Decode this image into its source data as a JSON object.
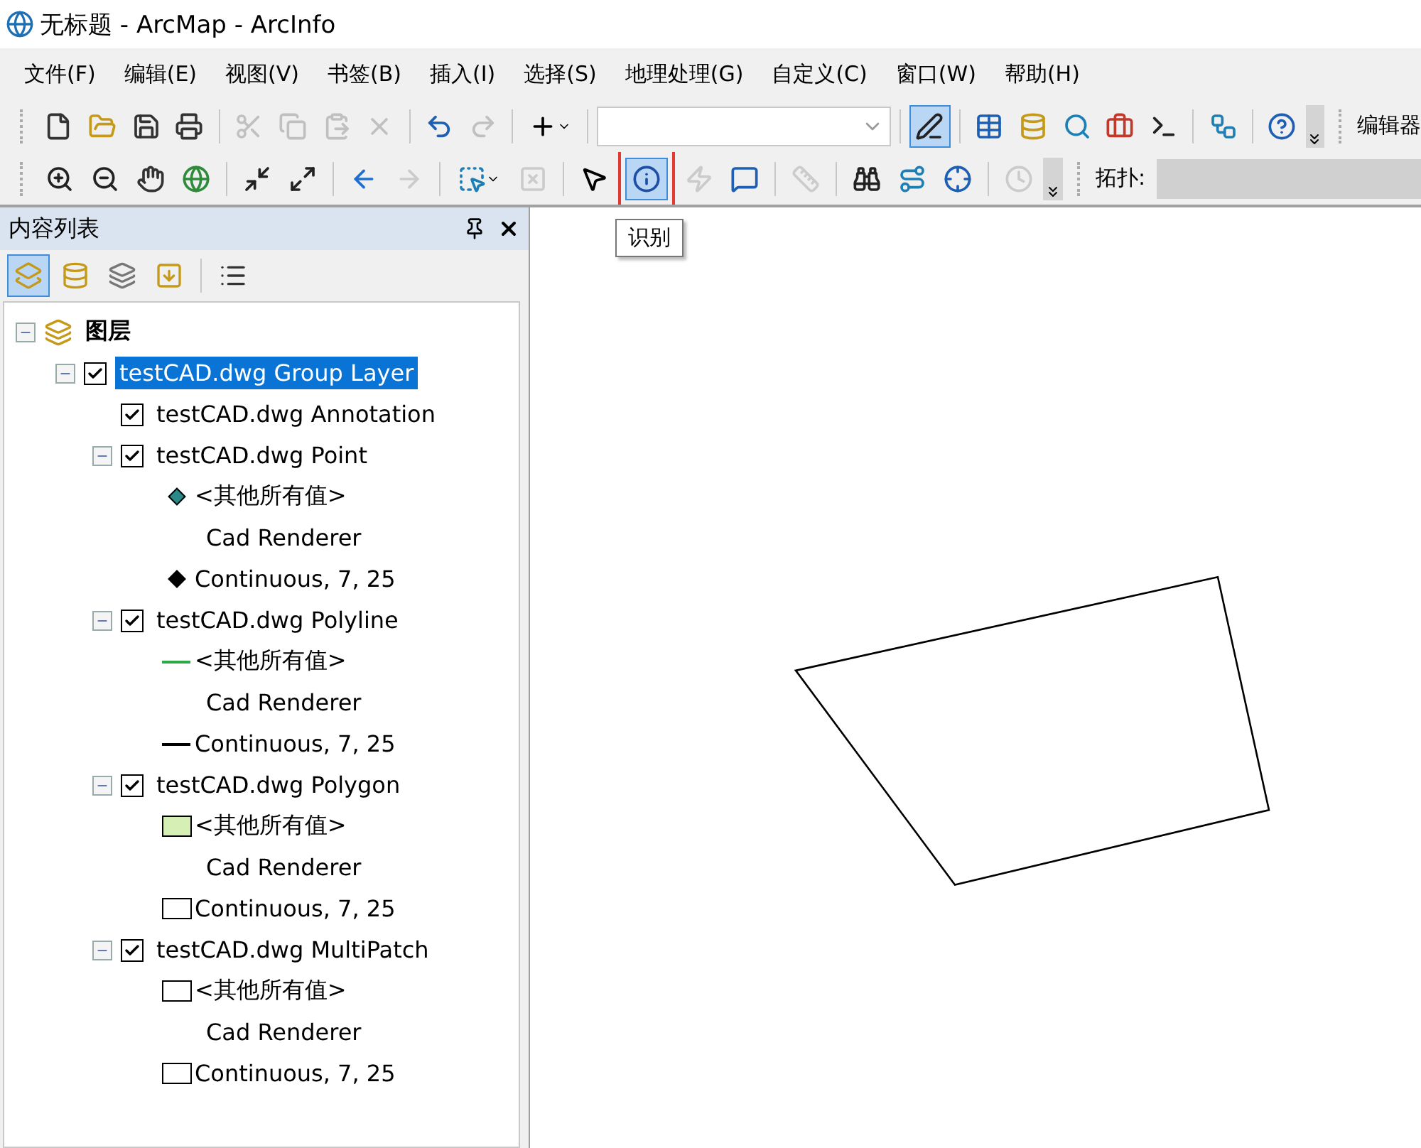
{
  "window": {
    "title": "无标题 - ArcMap - ArcInfo"
  },
  "menu": [
    {
      "label": "文件(F)"
    },
    {
      "label": "编辑(E)"
    },
    {
      "label": "视图(V)"
    },
    {
      "label": "书签(B)"
    },
    {
      "label": "插入(I)"
    },
    {
      "label": "选择(S)"
    },
    {
      "label": "地理处理(G)"
    },
    {
      "label": "自定义(C)"
    },
    {
      "label": "窗口(W)"
    },
    {
      "label": "帮助(H)"
    }
  ],
  "toolbar_1": {
    "tools": [
      {
        "kind": "new",
        "disabled": false,
        "selected": false
      },
      {
        "kind": "open",
        "disabled": false,
        "selected": false
      },
      {
        "kind": "save",
        "disabled": false,
        "selected": false
      },
      {
        "kind": "print",
        "disabled": false,
        "selected": false
      },
      {
        "kind": "separator"
      },
      {
        "kind": "cut",
        "disabled": true,
        "selected": false
      },
      {
        "kind": "copy",
        "disabled": true,
        "selected": false
      },
      {
        "kind": "paste",
        "disabled": true,
        "selected": false
      },
      {
        "kind": "delete",
        "disabled": true,
        "selected": false
      },
      {
        "kind": "separator"
      },
      {
        "kind": "undo",
        "disabled": false,
        "selected": false
      },
      {
        "kind": "redo",
        "disabled": true,
        "selected": false
      },
      {
        "kind": "separator"
      },
      {
        "kind": "add-data",
        "disabled": false,
        "selected": false,
        "dropdown": true
      },
      {
        "kind": "separator"
      },
      {
        "kind": "scale-combo"
      },
      {
        "kind": "separator"
      },
      {
        "kind": "editor",
        "disabled": false,
        "selected": true
      },
      {
        "kind": "separator"
      },
      {
        "kind": "table",
        "disabled": false,
        "selected": false
      },
      {
        "kind": "catalog",
        "disabled": false,
        "selected": false
      },
      {
        "kind": "search",
        "disabled": false,
        "selected": false
      },
      {
        "kind": "toolbox",
        "disabled": false,
        "selected": false
      },
      {
        "kind": "python",
        "disabled": false,
        "selected": false
      },
      {
        "kind": "separator"
      },
      {
        "kind": "model",
        "disabled": false,
        "selected": false
      },
      {
        "kind": "separator"
      },
      {
        "kind": "help",
        "disabled": false,
        "selected": false
      },
      {
        "kind": "overflow"
      }
    ],
    "next_label": "编辑器"
  },
  "toolbar_2": {
    "tools": [
      {
        "kind": "zoom-in",
        "disabled": false,
        "selected": false
      },
      {
        "kind": "zoom-out",
        "disabled": false,
        "selected": false
      },
      {
        "kind": "pan",
        "disabled": false,
        "selected": false
      },
      {
        "kind": "globe",
        "disabled": false,
        "selected": false
      },
      {
        "kind": "separator"
      },
      {
        "kind": "fixed-in",
        "disabled": false,
        "selected": false
      },
      {
        "kind": "fixed-out",
        "disabled": false,
        "selected": false
      },
      {
        "kind": "separator"
      },
      {
        "kind": "back",
        "disabled": false,
        "selected": false
      },
      {
        "kind": "forward",
        "disabled": true,
        "selected": false
      },
      {
        "kind": "separator"
      },
      {
        "kind": "select",
        "disabled": false,
        "selected": false,
        "dropdown": true
      },
      {
        "kind": "clear",
        "disabled": true,
        "selected": false
      },
      {
        "kind": "separator"
      },
      {
        "kind": "pointer",
        "disabled": false,
        "selected": false
      },
      {
        "kind": "identify",
        "disabled": false,
        "selected": true,
        "marked": true
      },
      {
        "kind": "hyperlink",
        "disabled": true,
        "selected": false
      },
      {
        "kind": "popup",
        "disabled": false,
        "selected": false
      },
      {
        "kind": "separator"
      },
      {
        "kind": "measure",
        "disabled": true,
        "selected": false
      },
      {
        "kind": "separator"
      },
      {
        "kind": "find",
        "disabled": false,
        "selected": false
      },
      {
        "kind": "route",
        "disabled": false,
        "selected": false
      },
      {
        "kind": "xy",
        "disabled": false,
        "selected": false
      },
      {
        "kind": "separator"
      },
      {
        "kind": "time",
        "disabled": true,
        "selected": false
      },
      {
        "kind": "overflow"
      }
    ],
    "next_label": "拓扑:"
  },
  "tooltip": "识别",
  "toc": {
    "title": "内容列表",
    "views": [
      {
        "kind": "drawing-order",
        "selected": true
      },
      {
        "kind": "source",
        "selected": false
      },
      {
        "kind": "visibility",
        "selected": false
      },
      {
        "kind": "selection",
        "selected": false
      },
      {
        "kind": "separator"
      },
      {
        "kind": "options",
        "selected": false
      }
    ],
    "root": {
      "label": "图层",
      "expanded": true,
      "children": [
        {
          "label": "testCAD.dwg Group Layer",
          "checked": true,
          "selected": true,
          "expanded": true,
          "children": [
            {
              "label": "testCAD.dwg Annotation",
              "checked": true,
              "selected": false
            },
            {
              "label": "testCAD.dwg Point",
              "checked": true,
              "selected": false,
              "expanded": true,
              "legend": [
                {
                  "kind": "marker",
                  "color": "#2a8a8a",
                  "label": "<其他所有值>"
                },
                {
                  "kind": "heading",
                  "label": "Cad Renderer"
                },
                {
                  "kind": "marker",
                  "color": "#000000",
                  "label": "Continuous, 7, 25"
                }
              ]
            },
            {
              "label": "testCAD.dwg Polyline",
              "checked": true,
              "selected": false,
              "expanded": true,
              "legend": [
                {
                  "kind": "line",
                  "color": "#2eaa44",
                  "label": "<其他所有值>"
                },
                {
                  "kind": "heading",
                  "label": "Cad Renderer"
                },
                {
                  "kind": "line",
                  "color": "#000000",
                  "label": "Continuous, 7, 25"
                }
              ]
            },
            {
              "label": "testCAD.dwg Polygon",
              "checked": true,
              "selected": false,
              "expanded": true,
              "legend": [
                {
                  "kind": "fill",
                  "color": "#d6efb4",
                  "label": "<其他所有值>"
                },
                {
                  "kind": "heading",
                  "label": "Cad Renderer"
                },
                {
                  "kind": "fill",
                  "color": "#ffffff",
                  "label": "Continuous, 7, 25"
                }
              ]
            },
            {
              "label": "testCAD.dwg MultiPatch",
              "checked": true,
              "selected": false,
              "expanded": true,
              "legend": [
                {
                  "kind": "fill",
                  "color": "#ffffff",
                  "label": "<其他所有值>"
                },
                {
                  "kind": "heading",
                  "label": "Cad Renderer"
                },
                {
                  "kind": "fill",
                  "color": "#ffffff",
                  "label": "Continuous, 7, 25"
                }
              ]
            }
          ]
        }
      ]
    }
  }
}
